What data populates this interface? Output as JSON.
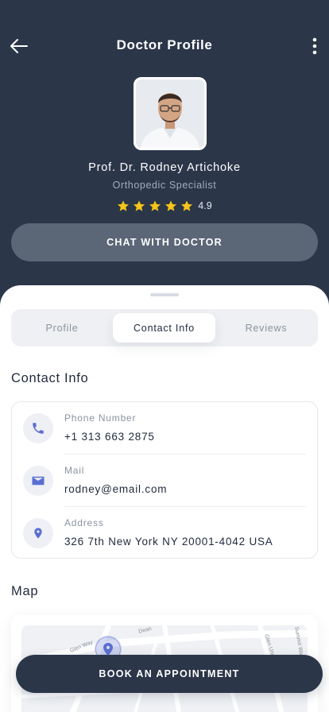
{
  "header": {
    "title": "Doctor Profile",
    "back_icon": "arrow-left-icon",
    "more_icon": "more-vertical-icon"
  },
  "doctor": {
    "name": "Prof. Dr. Rodney Artichoke",
    "specialty": "Orthopedic Specialist",
    "rating": "4.9",
    "stars": 5
  },
  "chat_button": "CHAT WITH DOCTOR",
  "tabs": [
    {
      "label": "Profile",
      "active": false
    },
    {
      "label": "Contact Info",
      "active": true
    },
    {
      "label": "Reviews",
      "active": false
    }
  ],
  "contact": {
    "title": "Contact Info",
    "items": [
      {
        "label": "Phone Number",
        "value": "+1 313 663 2875",
        "icon": "phone-icon"
      },
      {
        "label": "Mail",
        "value": "rodney@email.com",
        "icon": "mail-icon"
      },
      {
        "label": "Address",
        "value": "326 7th New York NY 20001-4042 USA",
        "icon": "location-pin-icon"
      }
    ]
  },
  "map": {
    "title": "Map",
    "street_labels": [
      "Glen Way",
      "Dean",
      "Glen Una",
      "Summit Way"
    ]
  },
  "book_button": "BOOK AN APPOINTMENT",
  "colors": {
    "primary": "#2b3649",
    "accent": "#5b6fd0",
    "star": "#f5c518",
    "chat_button": "#5b6677"
  }
}
